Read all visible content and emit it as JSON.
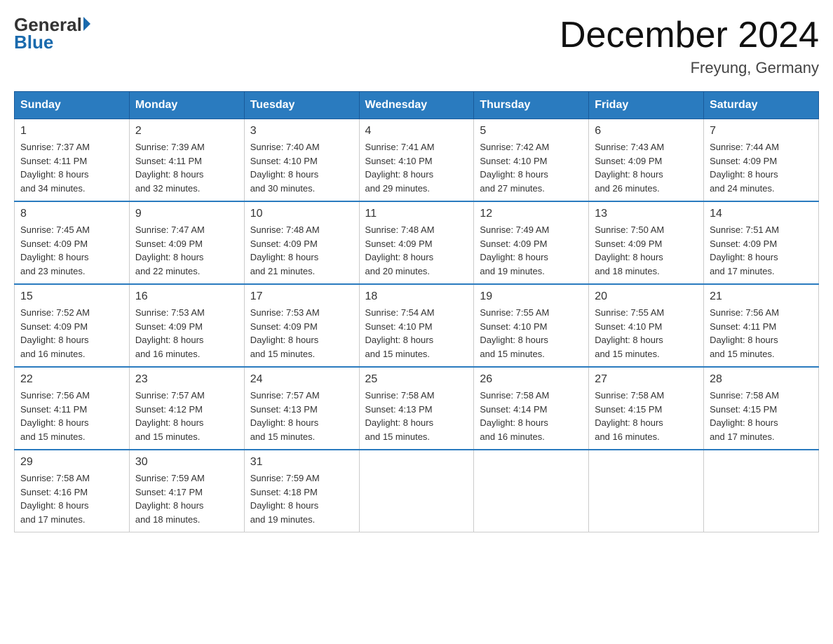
{
  "logo": {
    "general": "General",
    "blue": "Blue"
  },
  "title": "December 2024",
  "location": "Freyung, Germany",
  "days_header": [
    "Sunday",
    "Monday",
    "Tuesday",
    "Wednesday",
    "Thursday",
    "Friday",
    "Saturday"
  ],
  "weeks": [
    [
      {
        "day": "1",
        "sunrise": "7:37 AM",
        "sunset": "4:11 PM",
        "daylight": "8 hours and 34 minutes."
      },
      {
        "day": "2",
        "sunrise": "7:39 AM",
        "sunset": "4:11 PM",
        "daylight": "8 hours and 32 minutes."
      },
      {
        "day": "3",
        "sunrise": "7:40 AM",
        "sunset": "4:10 PM",
        "daylight": "8 hours and 30 minutes."
      },
      {
        "day": "4",
        "sunrise": "7:41 AM",
        "sunset": "4:10 PM",
        "daylight": "8 hours and 29 minutes."
      },
      {
        "day": "5",
        "sunrise": "7:42 AM",
        "sunset": "4:10 PM",
        "daylight": "8 hours and 27 minutes."
      },
      {
        "day": "6",
        "sunrise": "7:43 AM",
        "sunset": "4:09 PM",
        "daylight": "8 hours and 26 minutes."
      },
      {
        "day": "7",
        "sunrise": "7:44 AM",
        "sunset": "4:09 PM",
        "daylight": "8 hours and 24 minutes."
      }
    ],
    [
      {
        "day": "8",
        "sunrise": "7:45 AM",
        "sunset": "4:09 PM",
        "daylight": "8 hours and 23 minutes."
      },
      {
        "day": "9",
        "sunrise": "7:47 AM",
        "sunset": "4:09 PM",
        "daylight": "8 hours and 22 minutes."
      },
      {
        "day": "10",
        "sunrise": "7:48 AM",
        "sunset": "4:09 PM",
        "daylight": "8 hours and 21 minutes."
      },
      {
        "day": "11",
        "sunrise": "7:48 AM",
        "sunset": "4:09 PM",
        "daylight": "8 hours and 20 minutes."
      },
      {
        "day": "12",
        "sunrise": "7:49 AM",
        "sunset": "4:09 PM",
        "daylight": "8 hours and 19 minutes."
      },
      {
        "day": "13",
        "sunrise": "7:50 AM",
        "sunset": "4:09 PM",
        "daylight": "8 hours and 18 minutes."
      },
      {
        "day": "14",
        "sunrise": "7:51 AM",
        "sunset": "4:09 PM",
        "daylight": "8 hours and 17 minutes."
      }
    ],
    [
      {
        "day": "15",
        "sunrise": "7:52 AM",
        "sunset": "4:09 PM",
        "daylight": "8 hours and 16 minutes."
      },
      {
        "day": "16",
        "sunrise": "7:53 AM",
        "sunset": "4:09 PM",
        "daylight": "8 hours and 16 minutes."
      },
      {
        "day": "17",
        "sunrise": "7:53 AM",
        "sunset": "4:09 PM",
        "daylight": "8 hours and 15 minutes."
      },
      {
        "day": "18",
        "sunrise": "7:54 AM",
        "sunset": "4:10 PM",
        "daylight": "8 hours and 15 minutes."
      },
      {
        "day": "19",
        "sunrise": "7:55 AM",
        "sunset": "4:10 PM",
        "daylight": "8 hours and 15 minutes."
      },
      {
        "day": "20",
        "sunrise": "7:55 AM",
        "sunset": "4:10 PM",
        "daylight": "8 hours and 15 minutes."
      },
      {
        "day": "21",
        "sunrise": "7:56 AM",
        "sunset": "4:11 PM",
        "daylight": "8 hours and 15 minutes."
      }
    ],
    [
      {
        "day": "22",
        "sunrise": "7:56 AM",
        "sunset": "4:11 PM",
        "daylight": "8 hours and 15 minutes."
      },
      {
        "day": "23",
        "sunrise": "7:57 AM",
        "sunset": "4:12 PM",
        "daylight": "8 hours and 15 minutes."
      },
      {
        "day": "24",
        "sunrise": "7:57 AM",
        "sunset": "4:13 PM",
        "daylight": "8 hours and 15 minutes."
      },
      {
        "day": "25",
        "sunrise": "7:58 AM",
        "sunset": "4:13 PM",
        "daylight": "8 hours and 15 minutes."
      },
      {
        "day": "26",
        "sunrise": "7:58 AM",
        "sunset": "4:14 PM",
        "daylight": "8 hours and 16 minutes."
      },
      {
        "day": "27",
        "sunrise": "7:58 AM",
        "sunset": "4:15 PM",
        "daylight": "8 hours and 16 minutes."
      },
      {
        "day": "28",
        "sunrise": "7:58 AM",
        "sunset": "4:15 PM",
        "daylight": "8 hours and 17 minutes."
      }
    ],
    [
      {
        "day": "29",
        "sunrise": "7:58 AM",
        "sunset": "4:16 PM",
        "daylight": "8 hours and 17 minutes."
      },
      {
        "day": "30",
        "sunrise": "7:59 AM",
        "sunset": "4:17 PM",
        "daylight": "8 hours and 18 minutes."
      },
      {
        "day": "31",
        "sunrise": "7:59 AM",
        "sunset": "4:18 PM",
        "daylight": "8 hours and 19 minutes."
      },
      null,
      null,
      null,
      null
    ]
  ],
  "labels": {
    "sunrise": "Sunrise:",
    "sunset": "Sunset:",
    "daylight": "Daylight:"
  }
}
